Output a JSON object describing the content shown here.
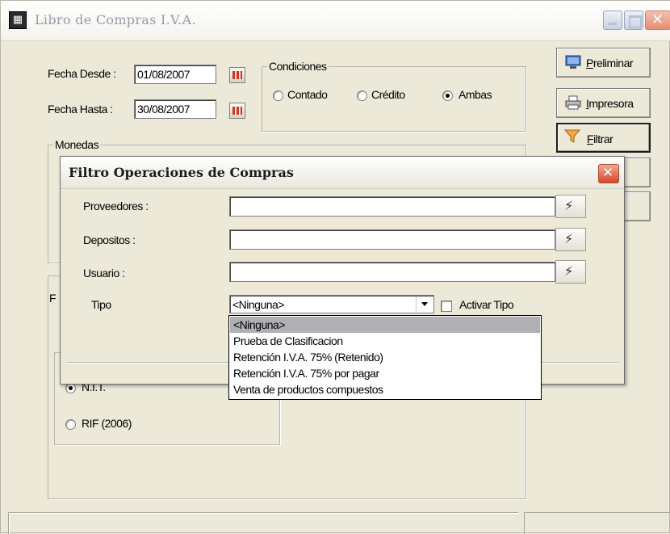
{
  "window": {
    "title": "Libro de Compras I.V.A."
  },
  "dates": {
    "desde_label": "Fecha Desde :",
    "desde_value": "01/08/2007",
    "hasta_label": "Fecha Hasta :",
    "hasta_value": "30/08/2007"
  },
  "condiciones": {
    "legend": "Condiciones",
    "options": [
      "Contado",
      "Crédito",
      "Ambas"
    ],
    "selected": "Ambas"
  },
  "monedas": {
    "legend": "Monedas"
  },
  "formato": {
    "opt1": "N.I.T.",
    "opt2": "RIF (2006)",
    "partial_label": "F"
  },
  "buttons": {
    "preliminar": "Preliminar",
    "impresora": "Impresora",
    "filtrar": "Filtrar"
  },
  "dialog": {
    "title": "Filtro Operaciones de Compras",
    "proveedores_label": "Proveedores :",
    "depositos_label": "Depositos :",
    "usuario_label": "Usuario :",
    "tipo_label": "Tipo",
    "tipo_value": "<Ninguna>",
    "activar_label": "Activar Tipo",
    "tipo_options": [
      "<Ninguna>",
      "Prueba de Clasificacion",
      "Retención I.V.A. 75% (Retenido)",
      "Retención I.V.A. 75% por pagar",
      "Venta de productos compuestos"
    ]
  },
  "icons": {
    "app": "app-icon",
    "calendar": "calendar-icon",
    "preview": "monitor-icon",
    "printer": "printer-icon",
    "filter": "funnel-icon",
    "lookup": "lookup-icon"
  },
  "colors": {
    "list_selection": "#aeb0b6",
    "dialog_close": "#d6492c"
  }
}
